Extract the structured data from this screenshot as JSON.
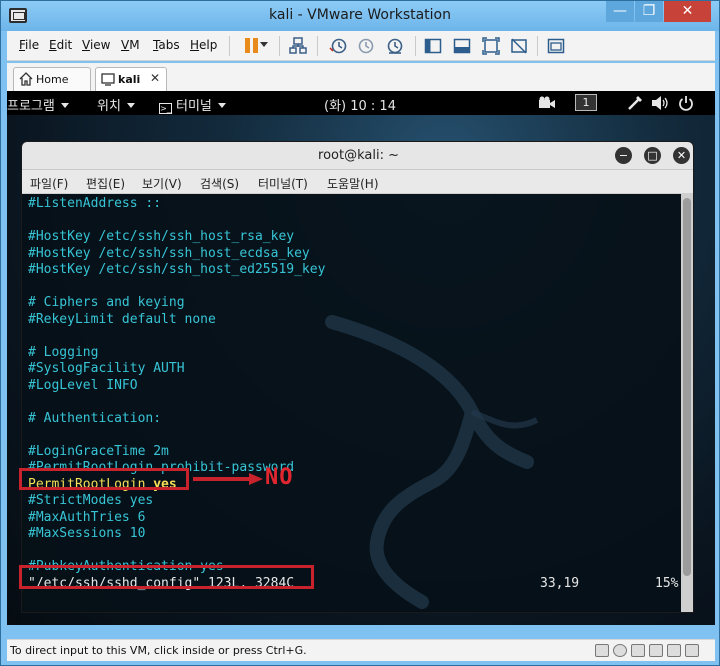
{
  "window": {
    "title": "kali - VMware Workstation",
    "min_label": "—",
    "max_label": "❐",
    "close_label": "✕"
  },
  "menubar": {
    "file": "File",
    "edit": "Edit",
    "view": "View",
    "vm": "VM",
    "tabs": "Tabs",
    "help": "Help"
  },
  "tabs": [
    {
      "label": "Home",
      "close": ""
    },
    {
      "label": "kali",
      "close": "✕"
    }
  ],
  "gnome": {
    "applications": "프로그램",
    "places": "위치",
    "terminal": "터미널",
    "clock": "(화) 10 : 14",
    "workspace": "1"
  },
  "terminal": {
    "title": "root@kali: ~",
    "menu": [
      "파일(F)",
      "편집(E)",
      "보기(V)",
      "검색(S)",
      "터미널(T)",
      "도움말(H)"
    ],
    "lines": [
      "#ListenAddress ::",
      "",
      "#HostKey /etc/ssh/ssh_host_rsa_key",
      "#HostKey /etc/ssh/ssh_host_ecdsa_key",
      "#HostKey /etc/ssh/ssh_host_ed25519_key",
      "",
      "# Ciphers and keying",
      "#RekeyLimit default none",
      "",
      "# Logging",
      "#SyslogFacility AUTH",
      "#LogLevel INFO",
      "",
      "# Authentication:",
      "",
      "#LoginGraceTime 2m",
      "#PermitRootLogin prohibit-password"
    ],
    "highlight_key": "PermitRootLogin",
    "highlight_value": "yes",
    "lines_after": [
      "#StrictModes yes",
      "#MaxAuthTries 6",
      "#MaxSessions 10",
      "",
      "#PubkeyAuthentication yes"
    ],
    "status_file": "\"/etc/ssh/sshd_config\" 123L, 3284C",
    "status_pos": "33,19",
    "status_pct": "15%"
  },
  "annotation": {
    "text": "NO",
    "color": "#c8232c"
  },
  "statusbar": {
    "text": "To direct input to this VM, click inside or press Ctrl+G."
  }
}
